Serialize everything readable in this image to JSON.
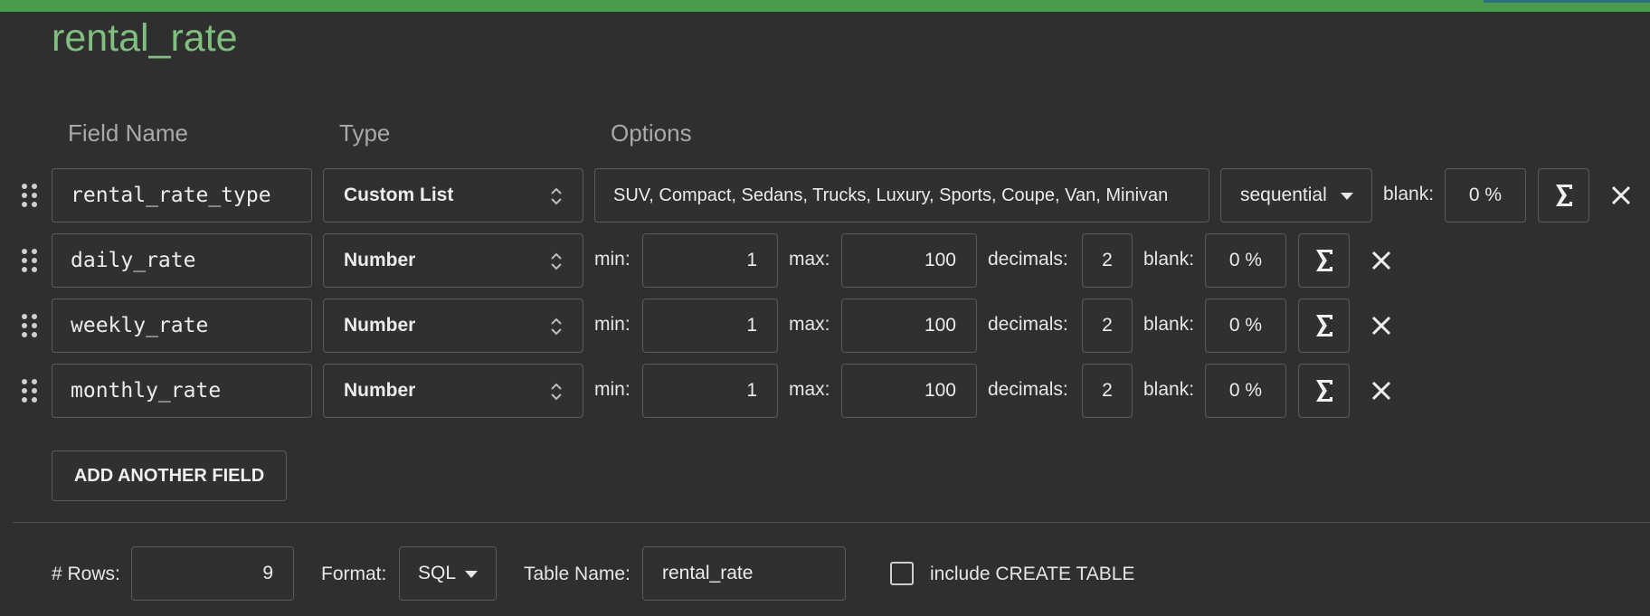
{
  "title": "rental_rate",
  "columns": {
    "field_name": "Field Name",
    "type": "Type",
    "options": "Options"
  },
  "fields": [
    {
      "name": "rental_rate_type",
      "type": "Custom List",
      "list_values": "SUV, Compact, Sedans, Trucks, Luxury, Sports, Coupe, Van, Minivan",
      "order": "sequential",
      "blank_label": "blank:",
      "blank": "0 %"
    },
    {
      "name": "daily_rate",
      "type": "Number",
      "min_label": "min:",
      "min": "1",
      "max_label": "max:",
      "max": "100",
      "decimals_label": "decimals:",
      "decimals": "2",
      "blank_label": "blank:",
      "blank": "0 %"
    },
    {
      "name": "weekly_rate",
      "type": "Number",
      "min_label": "min:",
      "min": "1",
      "max_label": "max:",
      "max": "100",
      "decimals_label": "decimals:",
      "decimals": "2",
      "blank_label": "blank:",
      "blank": "0 %"
    },
    {
      "name": "monthly_rate",
      "type": "Number",
      "min_label": "min:",
      "min": "1",
      "max_label": "max:",
      "max": "100",
      "decimals_label": "decimals:",
      "decimals": "2",
      "blank_label": "blank:",
      "blank": "0 %"
    }
  ],
  "add_field_label": "ADD ANOTHER FIELD",
  "footer": {
    "rows_label": "# Rows:",
    "rows": "9",
    "format_label": "Format:",
    "format": "SQL",
    "table_name_label": "Table Name:",
    "table_name": "rental_rate",
    "create_table_label": "include CREATE TABLE",
    "create_table_checked": false
  },
  "colors": {
    "accent": "#4b9b4e",
    "title": "#7fbf7f",
    "background": "#2f2f2f"
  },
  "icons": [
    "drag-handle-icon",
    "updown-chevron-icon",
    "caret-down-icon",
    "sigma-icon",
    "close-icon"
  ]
}
